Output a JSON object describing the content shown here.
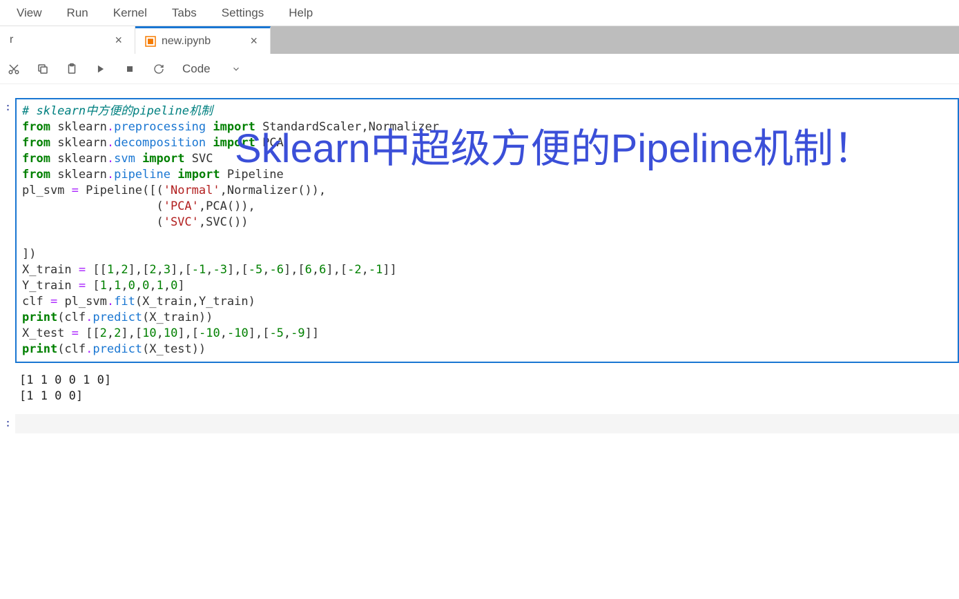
{
  "menu": {
    "items": [
      "View",
      "Run",
      "Kernel",
      "Tabs",
      "Settings",
      "Help"
    ]
  },
  "tabs": [
    {
      "label": "r",
      "active": false
    },
    {
      "label": "new.ipynb",
      "active": true
    }
  ],
  "toolbar": {
    "cell_type": "Code"
  },
  "overlay": "Sklearn中超级方便的Pipeline机制！",
  "cells": [
    {
      "prompt": ":",
      "type": "code",
      "active": true,
      "code_lines": [
        [
          {
            "t": "# sklearn中方便的pipeline机制",
            "c": "c-comment"
          }
        ],
        [
          {
            "t": "from",
            "c": "c-keyword"
          },
          {
            "t": " sklearn"
          },
          {
            "t": ".",
            "c": "c-op"
          },
          {
            "t": "preprocessing",
            "c": "c-module"
          },
          {
            "t": " "
          },
          {
            "t": "import",
            "c": "c-keyword"
          },
          {
            "t": " StandardScaler,Normalizer"
          }
        ],
        [
          {
            "t": "from",
            "c": "c-keyword"
          },
          {
            "t": " sklearn"
          },
          {
            "t": ".",
            "c": "c-op"
          },
          {
            "t": "decomposition",
            "c": "c-module"
          },
          {
            "t": " "
          },
          {
            "t": "import",
            "c": "c-keyword"
          },
          {
            "t": " PCA"
          }
        ],
        [
          {
            "t": "from",
            "c": "c-keyword"
          },
          {
            "t": " sklearn"
          },
          {
            "t": ".",
            "c": "c-op"
          },
          {
            "t": "svm",
            "c": "c-module"
          },
          {
            "t": " "
          },
          {
            "t": "import",
            "c": "c-keyword"
          },
          {
            "t": " SVC"
          }
        ],
        [
          {
            "t": "from",
            "c": "c-keyword"
          },
          {
            "t": " sklearn"
          },
          {
            "t": ".",
            "c": "c-op"
          },
          {
            "t": "pipeline",
            "c": "c-module"
          },
          {
            "t": " "
          },
          {
            "t": "import",
            "c": "c-keyword"
          },
          {
            "t": " Pipeline"
          }
        ],
        [
          {
            "t": "pl_svm "
          },
          {
            "t": "=",
            "c": "c-op"
          },
          {
            "t": " Pipeline([("
          },
          {
            "t": "'Normal'",
            "c": "c-str"
          },
          {
            "t": ",Normalizer()),"
          }
        ],
        [
          {
            "t": "                   ("
          },
          {
            "t": "'PCA'",
            "c": "c-str"
          },
          {
            "t": ",PCA()),"
          }
        ],
        [
          {
            "t": "                   ("
          },
          {
            "t": "'SVC'",
            "c": "c-str"
          },
          {
            "t": ",SVC())"
          }
        ],
        [
          {
            "t": ""
          }
        ],
        [
          {
            "t": "])"
          }
        ],
        [
          {
            "t": "X_train "
          },
          {
            "t": "=",
            "c": "c-op"
          },
          {
            "t": " [["
          },
          {
            "t": "1",
            "c": "c-num"
          },
          {
            "t": ","
          },
          {
            "t": "2",
            "c": "c-num"
          },
          {
            "t": "],["
          },
          {
            "t": "2",
            "c": "c-num"
          },
          {
            "t": ","
          },
          {
            "t": "3",
            "c": "c-num"
          },
          {
            "t": "],["
          },
          {
            "t": "-1",
            "c": "c-num"
          },
          {
            "t": ","
          },
          {
            "t": "-3",
            "c": "c-num"
          },
          {
            "t": "],["
          },
          {
            "t": "-5",
            "c": "c-num"
          },
          {
            "t": ","
          },
          {
            "t": "-6",
            "c": "c-num"
          },
          {
            "t": "],["
          },
          {
            "t": "6",
            "c": "c-num"
          },
          {
            "t": ","
          },
          {
            "t": "6",
            "c": "c-num"
          },
          {
            "t": "],["
          },
          {
            "t": "-2",
            "c": "c-num"
          },
          {
            "t": ","
          },
          {
            "t": "-1",
            "c": "c-num"
          },
          {
            "t": "]]"
          }
        ],
        [
          {
            "t": "Y_train "
          },
          {
            "t": "=",
            "c": "c-op"
          },
          {
            "t": " ["
          },
          {
            "t": "1",
            "c": "c-num"
          },
          {
            "t": ","
          },
          {
            "t": "1",
            "c": "c-num"
          },
          {
            "t": ","
          },
          {
            "t": "0",
            "c": "c-num"
          },
          {
            "t": ","
          },
          {
            "t": "0",
            "c": "c-num"
          },
          {
            "t": ","
          },
          {
            "t": "1",
            "c": "c-num"
          },
          {
            "t": ","
          },
          {
            "t": "0",
            "c": "c-num"
          },
          {
            "t": "]"
          }
        ],
        [
          {
            "t": "clf "
          },
          {
            "t": "=",
            "c": "c-op"
          },
          {
            "t": " pl_svm"
          },
          {
            "t": ".",
            "c": "c-op"
          },
          {
            "t": "fit",
            "c": "c-func"
          },
          {
            "t": "(X_train,Y_train)"
          }
        ],
        [
          {
            "t": "print",
            "c": "c-keyword"
          },
          {
            "t": "(clf"
          },
          {
            "t": ".",
            "c": "c-op"
          },
          {
            "t": "predict",
            "c": "c-func"
          },
          {
            "t": "(X_train))"
          }
        ],
        [
          {
            "t": "X_test "
          },
          {
            "t": "=",
            "c": "c-op"
          },
          {
            "t": " [["
          },
          {
            "t": "2",
            "c": "c-num"
          },
          {
            "t": ","
          },
          {
            "t": "2",
            "c": "c-num"
          },
          {
            "t": "],["
          },
          {
            "t": "10",
            "c": "c-num"
          },
          {
            "t": ","
          },
          {
            "t": "10",
            "c": "c-num"
          },
          {
            "t": "],["
          },
          {
            "t": "-10",
            "c": "c-num"
          },
          {
            "t": ","
          },
          {
            "t": "-10",
            "c": "c-num"
          },
          {
            "t": "],["
          },
          {
            "t": "-5",
            "c": "c-num"
          },
          {
            "t": ","
          },
          {
            "t": "-9",
            "c": "c-num"
          },
          {
            "t": "]]"
          }
        ],
        [
          {
            "t": "print",
            "c": "c-keyword"
          },
          {
            "t": "(clf"
          },
          {
            "t": ".",
            "c": "c-op"
          },
          {
            "t": "predict",
            "c": "c-func"
          },
          {
            "t": "(X_test))"
          }
        ]
      ],
      "output": "[1 1 0 0 1 0]\n[1 1 0 0]"
    },
    {
      "prompt": ":",
      "type": "code",
      "active": false,
      "code_lines": [],
      "output": ""
    }
  ]
}
